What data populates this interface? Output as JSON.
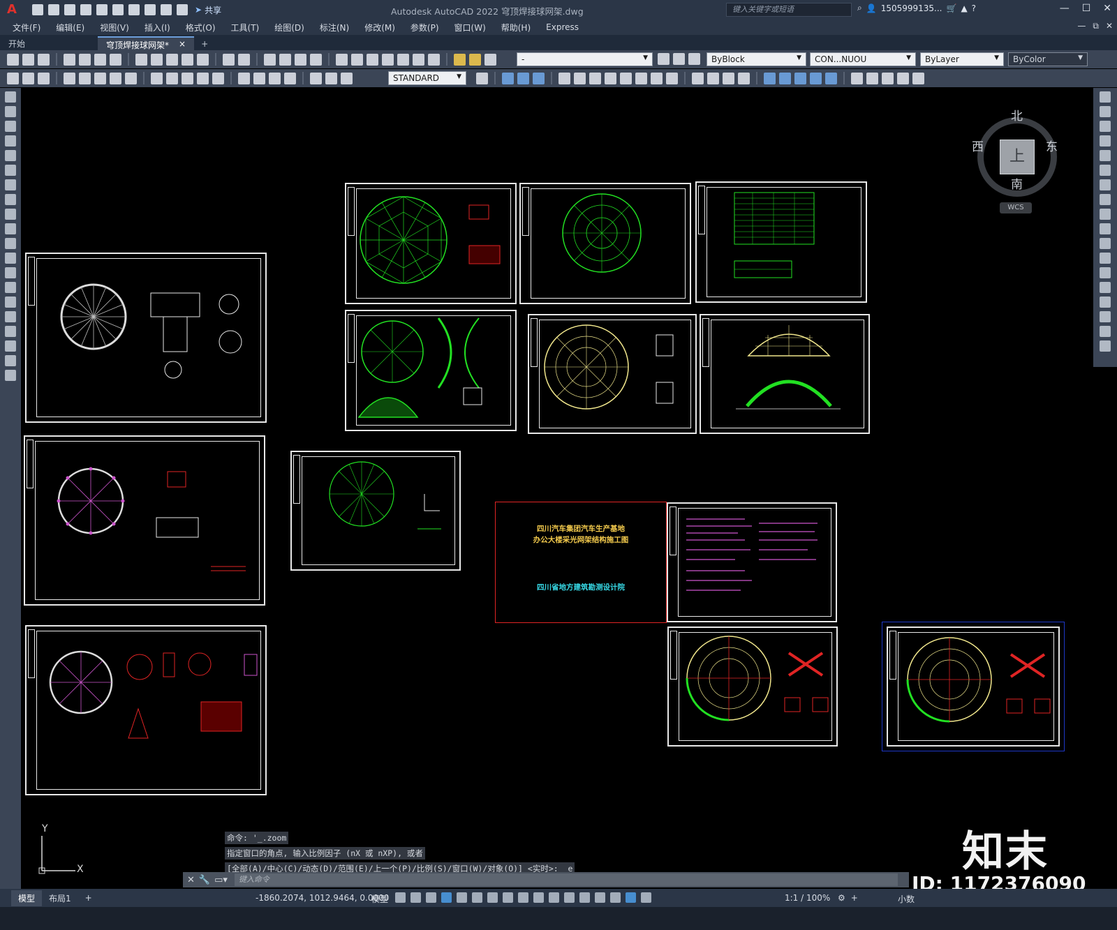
{
  "titlebar": {
    "app_logo": "A",
    "title": "Autodesk AutoCAD 2022    穹顶焊接球网架.dwg",
    "share": "共享",
    "search_placeholder": "键入关键字或短语",
    "user": "1505999135...",
    "help": "?"
  },
  "menu": [
    "文件(F)",
    "编辑(E)",
    "视图(V)",
    "插入(I)",
    "格式(O)",
    "工具(T)",
    "绘图(D)",
    "标注(N)",
    "修改(M)",
    "参数(P)",
    "窗口(W)",
    "帮助(H)",
    "Express"
  ],
  "tabs": {
    "start": "开始",
    "drawing": "穹顶焊接球网架*",
    "close": "×",
    "add": "+"
  },
  "toolbar": {
    "layer_combo": "-",
    "color_combo": "ByBlock",
    "linetype_combo": "CON...NUOU",
    "lineweight_combo": "ByLayer",
    "plotstyle_combo": "ByColor",
    "textstyle_combo": "STANDARD"
  },
  "viewcube": {
    "north": "北",
    "south": "南",
    "east": "东",
    "west": "西",
    "face": "上",
    "wcs": "WCS"
  },
  "cover_sheet": {
    "line1": "四川汽车集团汽车生产基地",
    "line2": "办公大楼采光网架结构施工图",
    "line3": "四川省地方建筑勘测设计院"
  },
  "ucs": {
    "y": "Y",
    "x": "X"
  },
  "command": {
    "history": [
      "命令: '_.zoom",
      "指定窗口的角点, 输入比例因子 (nX 或 nXP), 或者",
      "[全部(A)/中心(C)/动态(D)/范围(E)/上一个(P)/比例(S)/窗口(W)/对象(O)] <实时>: _e"
    ],
    "placeholder": "键入命令"
  },
  "statusbar": {
    "tab_model": "模型",
    "tab_layout": "布局1",
    "tab_add": "+",
    "coords": "-1860.2074, 1012.9464, 0.0000",
    "space": "模型",
    "scale": "1:1 / 100%",
    "units": "小数"
  },
  "watermark": {
    "logo": "知末",
    "id": "ID: 1172376090"
  },
  "colors": {
    "title_bg": "#2b3647",
    "toolbar_bg": "#3b4556",
    "canvas_bg": "#000000",
    "drawing_green": "#22e022",
    "drawing_yellow": "#f0e68c",
    "cover_red": "#e02424",
    "cover_yellow": "#f2c94c",
    "cover_cyan": "#37d9e6"
  }
}
